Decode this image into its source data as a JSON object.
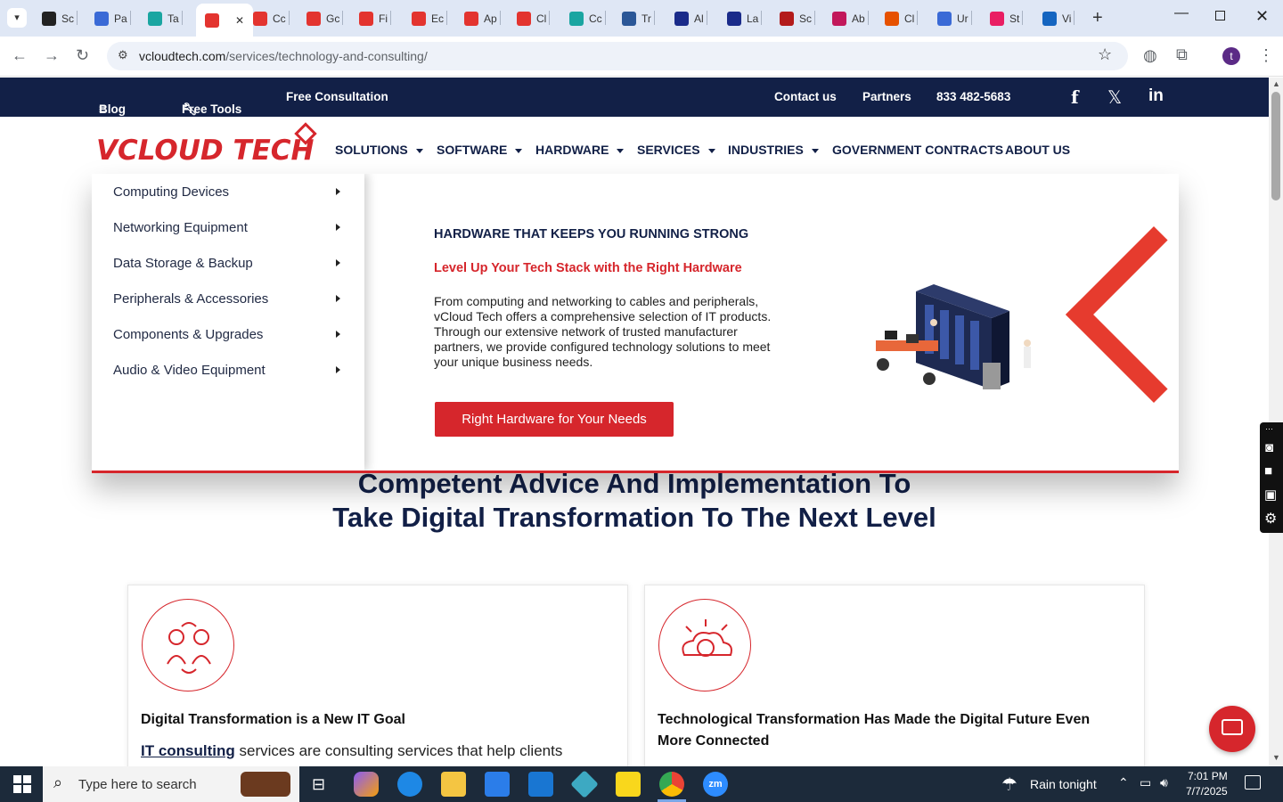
{
  "browser": {
    "tabs": [
      {
        "label": "Sc",
        "color": "#222"
      },
      {
        "label": "Pa",
        "color": "#3a6ad6"
      },
      {
        "label": "Ta",
        "color": "#1aa5a1"
      },
      {
        "label": "",
        "color": "#e3342f",
        "active": true
      },
      {
        "label": "Cc",
        "color": "#e3342f"
      },
      {
        "label": "Gc",
        "color": "#e3342f"
      },
      {
        "label": "Fi",
        "color": "#e3342f"
      },
      {
        "label": "Ec",
        "color": "#e3342f"
      },
      {
        "label": "Ap",
        "color": "#e3342f"
      },
      {
        "label": "Cl",
        "color": "#e3342f"
      },
      {
        "label": "Cc",
        "color": "#1aa5a1"
      },
      {
        "label": "Tr",
        "color": "#2b5797"
      },
      {
        "label": "Al",
        "color": "#1a2b8a"
      },
      {
        "label": "La",
        "color": "#1a2b8a"
      },
      {
        "label": "Sc",
        "color": "#b31b1b"
      },
      {
        "label": "Ab",
        "color": "#c2185b"
      },
      {
        "label": "Cl",
        "color": "#e65100"
      },
      {
        "label": "Ur",
        "color": "#3a6ad6"
      },
      {
        "label": "St",
        "color": "#e91e63"
      },
      {
        "label": "Vi",
        "color": "#1565c0"
      }
    ],
    "url_host": "vcloudtech.com",
    "url_path": "/services/technology-and-consulting/",
    "profile_initial": "t"
  },
  "topbar": {
    "blog": "Blog",
    "free_tools": "Free Tools",
    "free_consultation": "Free Consultation",
    "contact": "Contact us",
    "partners": "Partners",
    "phone": "833 482-5683"
  },
  "logo": {
    "part1": "V",
    "part2": "CLOUD TECH"
  },
  "nav": {
    "solutions": "SOLUTIONS",
    "software": "SOFTWARE",
    "hardware": "HARDWARE",
    "services": "SERVICES",
    "industries": "INDUSTRIES",
    "government": "GOVERNMENT CONTRACTS",
    "about": "ABOUT US"
  },
  "mega": {
    "items": [
      "Computing Devices",
      "Networking Equipment",
      "Data Storage & Backup",
      "Peripherals & Accessories",
      "Components & Upgrades",
      "Audio & Video Equipment"
    ],
    "heading": "HARDWARE THAT KEEPS YOU RUNNING STRONG",
    "subheading": "Level Up Your Tech Stack with the Right Hardware",
    "body": "From computing and networking to cables and peripherals, vCloud Tech offers a comprehensive selection of IT products. Through our extensive network of trusted manufacturer partners, we provide configured technology solutions to meet your unique business needs.",
    "cta": "Right Hardware for Your Needs"
  },
  "content": {
    "heading": "Competent Advice And Implementation To Take Digital Transformation To The Next Level",
    "card1_title": "Digital Transformation is a New IT Goal",
    "card1_link": "IT consulting",
    "card1_text": " services are consulting services that help clients",
    "card2_title": "Technological Transformation Has Made the Digital Future Even More Connected"
  },
  "taskbar": {
    "search_placeholder": "Type here to search",
    "weather": "Rain tonight",
    "time": "7:01 PM",
    "date": "7/7/2025"
  },
  "colors": {
    "brand_navy": "#122047",
    "brand_red": "#d6262c"
  }
}
